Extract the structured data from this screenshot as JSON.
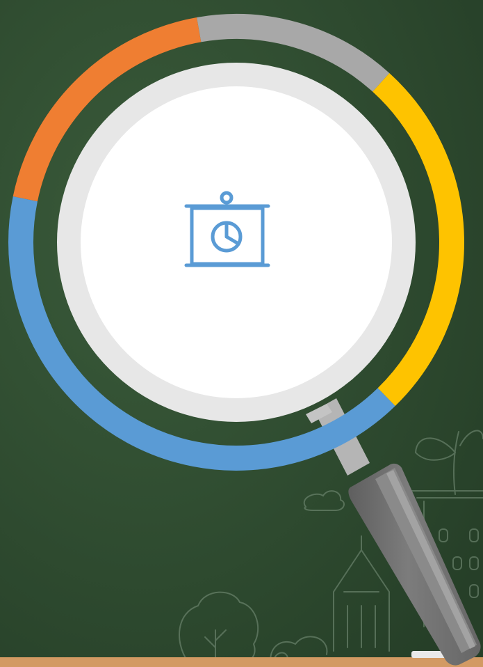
{
  "colors": {
    "board_dark": "#263f28",
    "board_light": "#3a5b3a",
    "chalk_line": "#7c947e",
    "ledge": "#d39a63",
    "ring_gray": "#a8a8a8",
    "ring_yellow": "#fec300",
    "ring_blue": "#5a9bd5",
    "ring_orange": "#ef7e32",
    "lens_rim": "#e7e7e7",
    "lens_face": "#ffffff",
    "handle_dark": "#6e6e6e",
    "handle_mid": "#8a8a8a",
    "handle_light": "#b5b5b5",
    "icon_blue": "#5a9bd5"
  },
  "icons": {
    "main": "presentation-board-pie-chart-icon",
    "tool": "magnifying-glass-icon"
  },
  "ring_segments": [
    {
      "name": "gray",
      "share": 0.145
    },
    {
      "name": "yellow",
      "share": 0.26
    },
    {
      "name": "blue",
      "share": 0.405
    },
    {
      "name": "orange",
      "share": 0.19
    }
  ]
}
